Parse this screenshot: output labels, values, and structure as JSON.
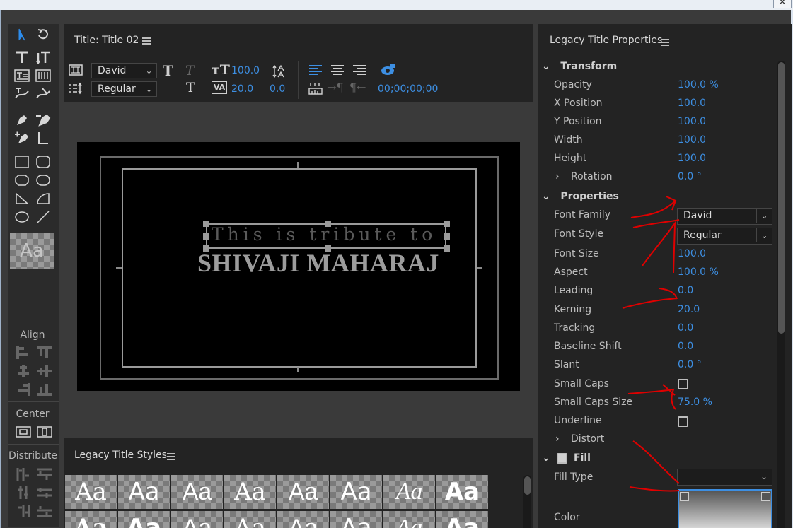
{
  "window": {
    "close_glyph": "✕"
  },
  "title_panel": {
    "header": "Title: Title 02",
    "font_family": "David",
    "font_style": "Regular",
    "font_size": "100.0",
    "kerning": "20.0",
    "leading": "0.0",
    "timecode": "00;00;00;00"
  },
  "canvas": {
    "line1": "This is tribute to",
    "line2": "SHIVAJI MAHARAJ"
  },
  "toolbox": {
    "align_label": "Align",
    "center_label": "Center",
    "distribute_label": "Distribute",
    "style_sample": "Aa"
  },
  "styles_panel": {
    "header": "Legacy Title Styles",
    "swatches": [
      "Aa",
      "Aa",
      "Aa",
      "Aa",
      "Aa",
      "Aa",
      "Aa",
      "Aa",
      "Aa",
      "Aa",
      "Aa",
      "Aa",
      "Aa",
      "Aa",
      "Aa",
      "Aa"
    ]
  },
  "props": {
    "header": "Legacy Title Properties",
    "transform_label": "Transform",
    "properties_label": "Properties",
    "fill_label": "Fill",
    "rows": [
      {
        "label": "Opacity",
        "value": "100.0 %"
      },
      {
        "label": "X Position",
        "value": "100.0"
      },
      {
        "label": "Y Position",
        "value": "100.0"
      },
      {
        "label": "Width",
        "value": "100.0"
      },
      {
        "label": "Height",
        "value": "100.0"
      },
      {
        "label": "Rotation",
        "value": "0.0 °"
      }
    ],
    "prop_rows": [
      {
        "label": "Font Family",
        "value": "David"
      },
      {
        "label": "Font Style",
        "value": "Regular"
      },
      {
        "label": "Font Size",
        "value": "100.0"
      },
      {
        "label": "Aspect",
        "value": "100.0 %"
      },
      {
        "label": "Leading",
        "value": "0.0"
      },
      {
        "label": "Kerning",
        "value": "20.0"
      },
      {
        "label": "Tracking",
        "value": "0.0"
      },
      {
        "label": "Baseline Shift",
        "value": "0.0"
      },
      {
        "label": "Slant",
        "value": "0.0 °"
      },
      {
        "label": "Small Caps",
        "value": ""
      },
      {
        "label": "Small Caps Size",
        "value": "75.0 %"
      },
      {
        "label": "Underline",
        "value": ""
      },
      {
        "label": "Distort",
        "value": ""
      }
    ],
    "fill_type_label": "Fill Type",
    "color_label": "Color"
  },
  "colors": {
    "accent": "#3d8fe3",
    "panel": "#232323",
    "annotation": "#e00000"
  }
}
